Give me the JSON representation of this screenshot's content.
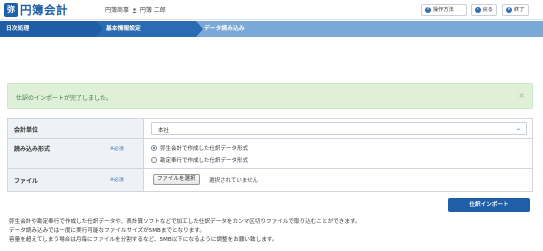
{
  "app": {
    "logo_mark": "弥",
    "logo_text": "円簿会計",
    "tenant": "円簿商事",
    "user": "円簿 二郎"
  },
  "header_buttons": {
    "help": "操作方法",
    "back": "戻る",
    "close": "終了"
  },
  "steps": [
    "日次処理",
    "基本情報設定",
    "データ読み込み"
  ],
  "alert": {
    "message": "仕訳のインポートが完了しました。",
    "close": "×"
  },
  "form": {
    "unit": {
      "label": "会計単位",
      "value": "本社"
    },
    "format": {
      "label": "読み込み形式",
      "required": "※必須",
      "options": [
        {
          "label": "弥生会計で作成した仕訳データ形式",
          "selected": true
        },
        {
          "label": "勘定奉行で作成した仕訳データ形式",
          "selected": false
        }
      ]
    },
    "file": {
      "label": "ファイル",
      "required": "※必須",
      "button": "ファイルを選択",
      "status": "選択されていません"
    }
  },
  "import_button": "仕訳インポート",
  "notes": [
    "弥生会計や勘定奉行で作成した仕訳データや、表計算ソフトなどで加工した仕訳データをカンマ区切りファイルで取り込むことができます。",
    "データ読み込みでは一度に実行可能なファイルサイズが5MBまでとなります。",
    "容量を超えてしまう場合は月毎にファイルを分割するなど、5MB以下になるように調整をお願い致します。"
  ],
  "colors": {
    "brand": "#1e5fa8",
    "step_active": "#1f5ea7",
    "alert_bg": "#dff0d8",
    "alert_text": "#3c763d"
  }
}
